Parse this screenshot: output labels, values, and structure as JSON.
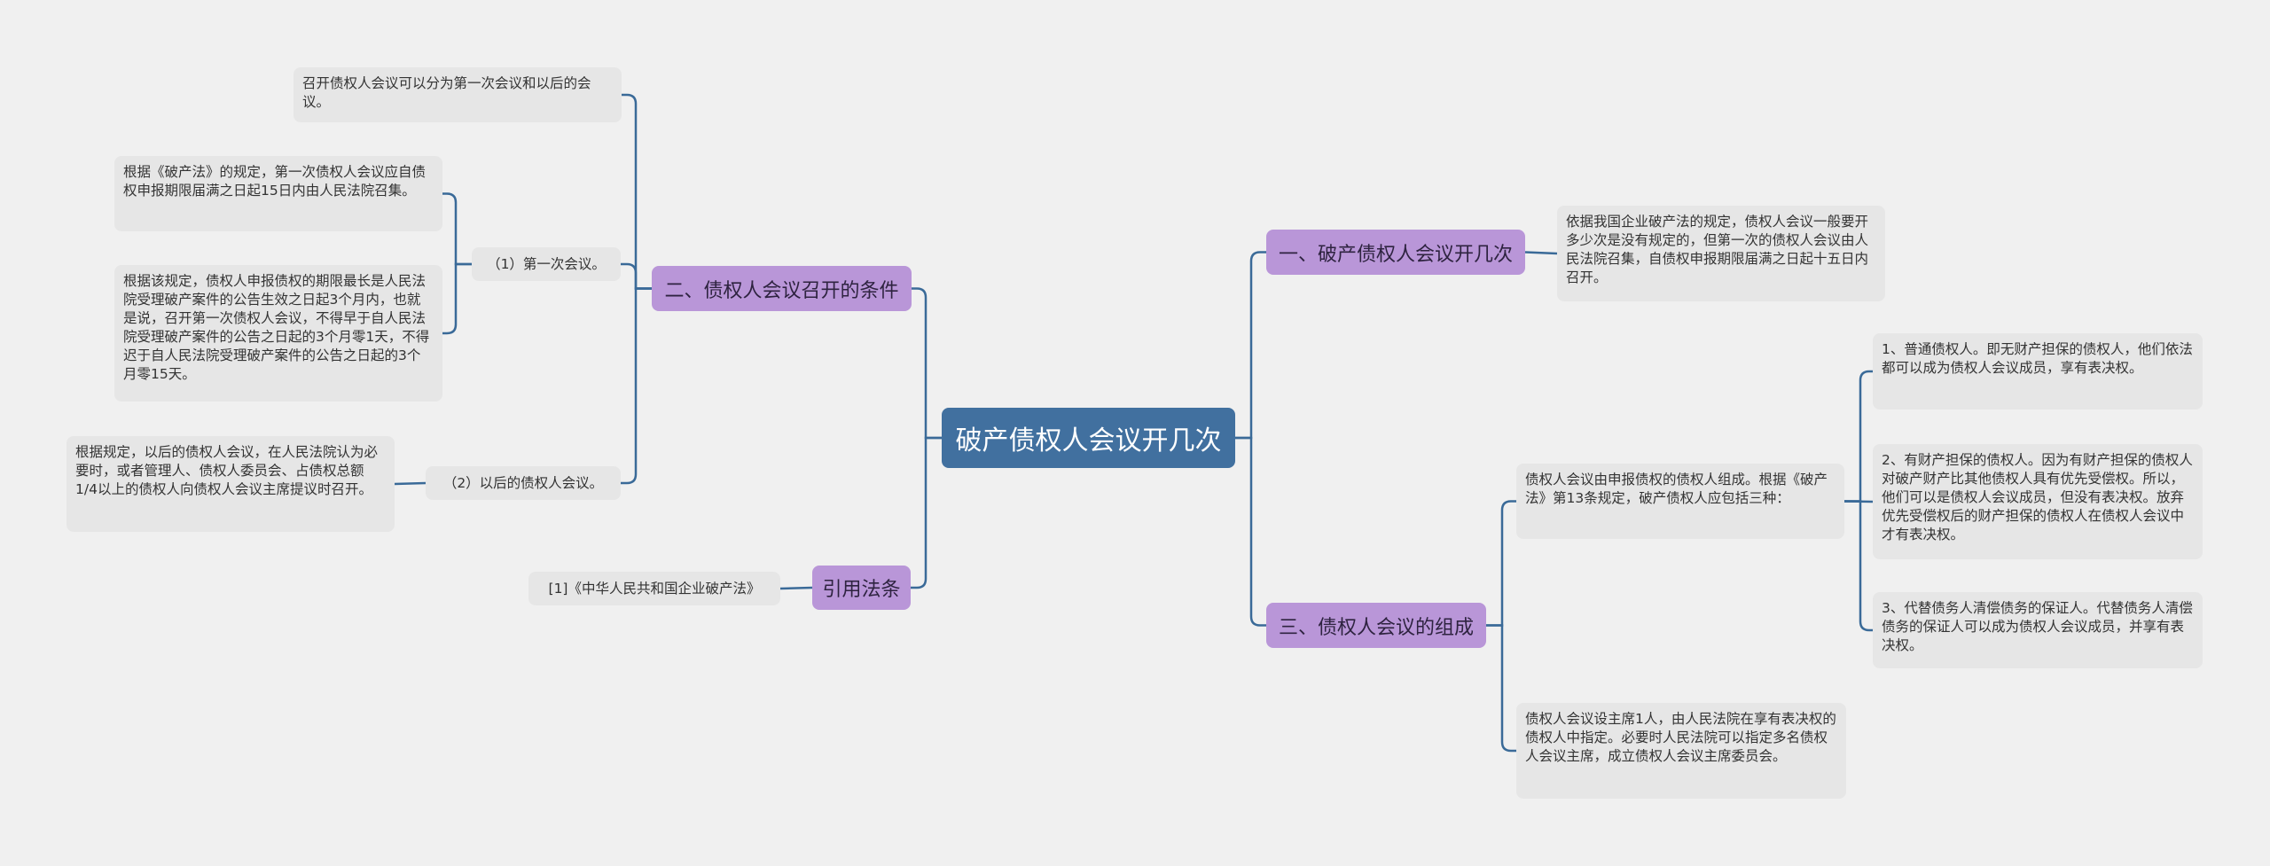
{
  "colors": {
    "root": "#41709f",
    "branch": "#b996d8",
    "leaf": "#e6e6e6",
    "link": "#3a6a98",
    "background": "#f0f0f0"
  },
  "root": {
    "label": "破产债权人会议开几次"
  },
  "right": [
    {
      "label": "一、破产债权人会议开几次",
      "children": [
        {
          "text": "依据我国企业破产法的规定，债权人会议一般要开多少次是没有规定的，但第一次的债权人会议由人民法院召集，自债权申报期限届满之日起十五日内召开。"
        }
      ]
    },
    {
      "label": "三、债权人会议的组成",
      "children": [
        {
          "text": "债权人会议由申报债权的债权人组成。根据《破产法》第13条规定，破产债权人应包括三种：",
          "children": [
            {
              "text": "1、普通债权人。即无财产担保的债权人，他们依法都可以成为债权人会议成员，享有表决权。"
            },
            {
              "text": "2、有财产担保的债权人。因为有财产担保的债权人对破产财产比其他债权人具有优先受偿权。所以，他们可以是债权人会议成员，但没有表决权。放弃优先受偿权后的财产担保的债权人在债权人会议中才有表决权。"
            },
            {
              "text": "3、代替债务人清偿债务的保证人。代替债务人清偿债务的保证人可以成为债权人会议成员，并享有表决权。"
            }
          ]
        },
        {
          "text": "债权人会议设主席1人，由人民法院在享有表决权的债权人中指定。必要时人民法院可以指定多名债权人会议主席，成立债权人会议主席委员会。"
        }
      ]
    }
  ],
  "left": [
    {
      "label": "二、债权人会议召开的条件",
      "children": [
        {
          "text": "召开债权人会议可以分为第一次会议和以后的会议。"
        },
        {
          "text": "（1）第一次会议。",
          "children": [
            {
              "text": "根据《破产法》的规定，第一次债权人会议应自债权申报期限届满之日起15日内由人民法院召集。"
            },
            {
              "text": "根据该规定，债权人申报债权的期限最长是人民法院受理破产案件的公告生效之日起3个月内，也就是说，召开第一次债权人会议，不得早于自人民法院受理破产案件的公告之日起的3个月零1天，不得迟于自人民法院受理破产案件的公告之日起的3个月零15天。"
            }
          ]
        },
        {
          "text": "（2）以后的债权人会议。",
          "children": [
            {
              "text": "根据规定，以后的债权人会议，在人民法院认为必要时，或者管理人、债权人委员会、占债权总额1/4以上的债权人向债权人会议主席提议时召开。"
            }
          ]
        }
      ]
    },
    {
      "label": "引用法条",
      "children": [
        {
          "text": "[1]《中华人民共和国企业破产法》"
        }
      ]
    }
  ]
}
